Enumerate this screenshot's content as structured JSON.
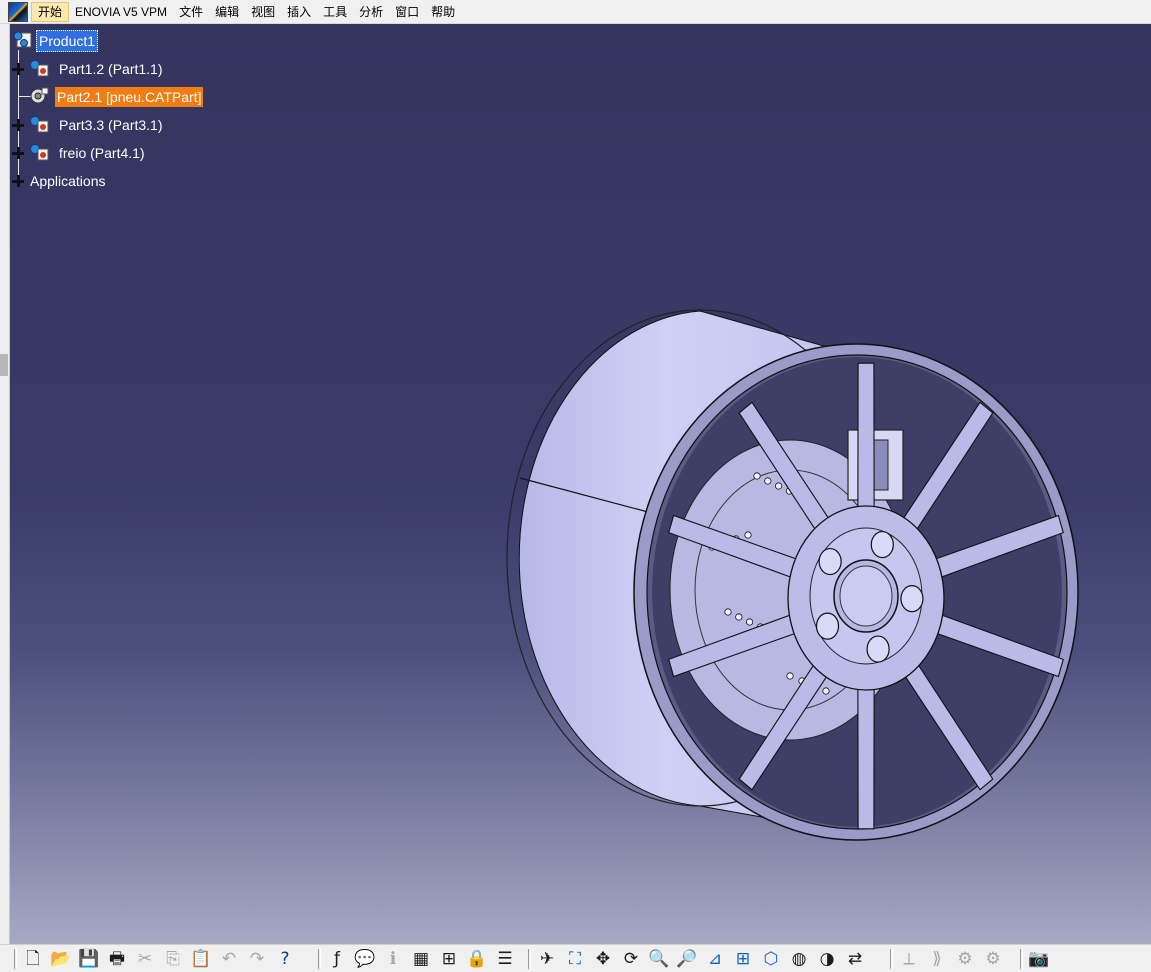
{
  "menubar": {
    "items": [
      "开始",
      "ENOVIA V5 VPM",
      "文件",
      "编辑",
      "视图",
      "插入",
      "工具",
      "分析",
      "窗口",
      "帮助"
    ],
    "active_item": "开始"
  },
  "tree": {
    "root": "Product1",
    "nodes": [
      {
        "label": "Part1.2 (Part1.1)",
        "expandable": true
      },
      {
        "label": "Part2.1 [pneu.CATPart]",
        "expandable": false,
        "selected": true
      },
      {
        "label": "Part3.3 (Part3.1)",
        "expandable": true
      },
      {
        "label": "freio (Part4.1)",
        "expandable": true
      }
    ],
    "applications": "Applications"
  },
  "colors": {
    "background_top": "#34345f",
    "background_bottom": "#a8a9c3",
    "part_fill": "#c6c6f2",
    "root_selection": "#2f6fe0",
    "node_selection": "#f07c12"
  },
  "toolbar": {
    "buttons": [
      {
        "name": "new-icon",
        "title": "New"
      },
      {
        "name": "open-icon",
        "title": "Open"
      },
      {
        "name": "save-icon",
        "title": "Save"
      },
      {
        "name": "print-icon",
        "title": "Print"
      },
      {
        "name": "cut-icon",
        "title": "Cut"
      },
      {
        "name": "copy-icon",
        "title": "Copy"
      },
      {
        "name": "paste-icon",
        "title": "Paste"
      },
      {
        "name": "undo-icon",
        "title": "Undo"
      },
      {
        "name": "redo-icon",
        "title": "Redo"
      },
      {
        "name": "whats-this-icon",
        "title": "What's This?"
      },
      {
        "name": "formula-icon",
        "title": "Formula"
      },
      {
        "name": "comment-icon",
        "title": "Comment"
      },
      {
        "name": "knowledge-icon",
        "title": "Knowledge"
      },
      {
        "name": "table-icon",
        "title": "Design Table"
      },
      {
        "name": "tree-expand-icon",
        "title": "Tree"
      },
      {
        "name": "lock-icon",
        "title": "Lock"
      },
      {
        "name": "list-icon",
        "title": "List"
      },
      {
        "name": "fly-mode-icon",
        "title": "Fly"
      },
      {
        "name": "fit-all-icon",
        "title": "Fit All In"
      },
      {
        "name": "pan-icon",
        "title": "Pan"
      },
      {
        "name": "rotate-icon",
        "title": "Rotate"
      },
      {
        "name": "zoom-in-icon",
        "title": "Zoom In"
      },
      {
        "name": "zoom-out-icon",
        "title": "Zoom Out"
      },
      {
        "name": "normal-view-icon",
        "title": "Normal View"
      },
      {
        "name": "multi-view-icon",
        "title": "Multi-View"
      },
      {
        "name": "iso-view-icon",
        "title": "Isometric View"
      },
      {
        "name": "shading-icon",
        "title": "Shading"
      },
      {
        "name": "hide-show-icon",
        "title": "Hide/Show"
      },
      {
        "name": "swap-visible-icon",
        "title": "Swap Visible Space"
      },
      {
        "name": "measure-icon",
        "title": "Measure"
      },
      {
        "name": "analysis-icon",
        "title": "Analysis"
      },
      {
        "name": "macro-icon",
        "title": "Macro"
      },
      {
        "name": "assemble-icon",
        "title": "Assemble"
      },
      {
        "name": "camera-icon",
        "title": "Capture"
      }
    ]
  }
}
